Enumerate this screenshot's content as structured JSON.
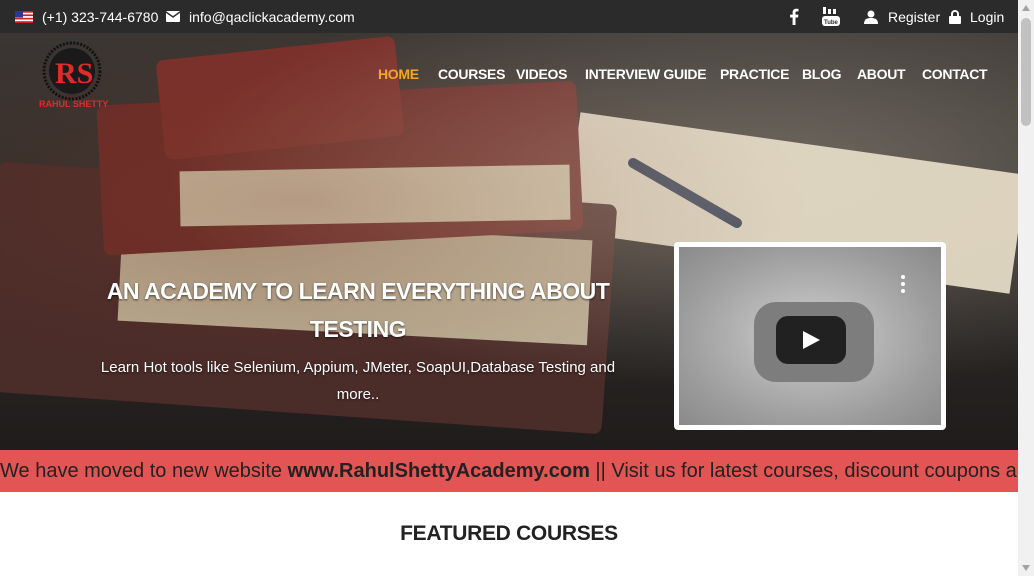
{
  "topbar": {
    "phone": "(+1) 323-744-6780",
    "email": "info@qaclickacademy.com",
    "register_label": "Register",
    "login_label": "Login",
    "icons": [
      "us-flag-icon",
      "envelope-icon",
      "facebook-icon",
      "youtube-icon",
      "user-icon",
      "lock-icon"
    ]
  },
  "logo": {
    "name": "RAHUL SHETTY"
  },
  "nav": {
    "items": [
      "HOME",
      "COURSES",
      "VIDEOS",
      "INTERVIEW GUIDE",
      "PRACTICE",
      "BLOG",
      "ABOUT",
      "CONTACT"
    ],
    "active": "HOME"
  },
  "hero": {
    "headline": "AN ACADEMY TO LEARN EVERYTHING ABOUT TESTING",
    "subline": "Learn Hot tools like Selenium, Appium, JMeter, SoapUI,Database Testing and more.."
  },
  "video": {
    "icons": [
      "play-icon",
      "more-vertical-icon"
    ]
  },
  "marquee": {
    "prefix": "We have moved to new website ",
    "link": "www.RahulShettyAcademy.com",
    "suffix": " || Visit us for latest courses, discount coupons and ne"
  },
  "section": {
    "featured_title": "FEATURED COURSES"
  },
  "colors": {
    "topbar": "#2b2b2b",
    "nav_active": "#f5a623",
    "marquee_bg": "#e35555",
    "text_dark": "#222222"
  }
}
